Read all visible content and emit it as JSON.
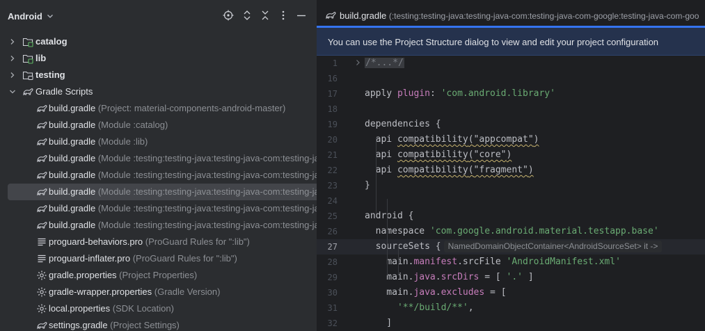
{
  "project_panel": {
    "view_name": "Android",
    "icons": [
      "locate-icon",
      "expand-all-icon",
      "collapse-all-icon",
      "more-options-icon",
      "hide-panel-icon"
    ],
    "tree": [
      {
        "label": "catalog",
        "hint": "",
        "icon": "module-folder-icon",
        "expandable": true,
        "bold": true
      },
      {
        "label": "lib",
        "hint": "",
        "icon": "module-folder-icon",
        "expandable": true,
        "bold": true
      },
      {
        "label": "testing",
        "hint": "",
        "icon": "folder-icon",
        "expandable": true,
        "bold": true
      },
      {
        "label": "Gradle Scripts",
        "hint": "",
        "icon": "gradle-icon",
        "expanded": true,
        "bold": false
      },
      {
        "label": "build.gradle",
        "hint": "(Project: material-components-android-master)",
        "icon": "gradle-icon"
      },
      {
        "label": "build.gradle",
        "hint": "(Module :catalog)",
        "icon": "gradle-icon"
      },
      {
        "label": "build.gradle",
        "hint": "(Module :lib)",
        "icon": "gradle-icon"
      },
      {
        "label": "build.gradle",
        "hint": "(Module :testing:testing-java:testing-java-com:testing-java-",
        "icon": "gradle-icon"
      },
      {
        "label": "build.gradle",
        "hint": "(Module :testing:testing-java:testing-java-com:testing-java-",
        "icon": "gradle-icon"
      },
      {
        "label": "build.gradle",
        "hint": "(Module :testing:testing-java:testing-java-com:testing-java-",
        "icon": "gradle-icon",
        "selected": true
      },
      {
        "label": "build.gradle",
        "hint": "(Module :testing:testing-java:testing-java-com:testing-java-",
        "icon": "gradle-icon"
      },
      {
        "label": "build.gradle",
        "hint": "(Module :testing:testing-java:testing-java-com:testing-java-",
        "icon": "gradle-icon"
      },
      {
        "label": "proguard-behaviors.pro",
        "hint": "(ProGuard Rules for \":lib\")",
        "icon": "text-file-icon"
      },
      {
        "label": "proguard-inflater.pro",
        "hint": "(ProGuard Rules for \":lib\")",
        "icon": "text-file-icon"
      },
      {
        "label": "gradle.properties",
        "hint": "(Project Properties)",
        "icon": "settings-file-icon"
      },
      {
        "label": "gradle-wrapper.properties",
        "hint": "(Gradle Version)",
        "icon": "settings-file-icon"
      },
      {
        "label": "local.properties",
        "hint": "(SDK Location)",
        "icon": "settings-file-icon"
      },
      {
        "label": "settings.gradle",
        "hint": "(Project Settings)",
        "icon": "gradle-icon"
      }
    ]
  },
  "editor": {
    "tab": {
      "label": "build.gradle",
      "hint": "(:testing:testing-java:testing-java-com:testing-java-com-google:testing-java-com-goo"
    },
    "banner": "You can use the Project Structure dialog to view and edit your project configuration",
    "current_line": "27",
    "lines": [
      {
        "n": "1",
        "tokens": [
          {
            "t": "/*...*/",
            "c": "cm fold-box"
          }
        ]
      },
      {
        "n": "16",
        "tokens": []
      },
      {
        "n": "17",
        "tokens": [
          {
            "t": "apply ",
            "c": ""
          },
          {
            "t": "plugin",
            "c": "p"
          },
          {
            "t": ": ",
            "c": ""
          },
          {
            "t": "'com.android.library'",
            "c": "s"
          }
        ]
      },
      {
        "n": "18",
        "tokens": []
      },
      {
        "n": "19",
        "tokens": [
          {
            "t": "dependencies {",
            "c": ""
          }
        ]
      },
      {
        "n": "20",
        "tokens": [
          {
            "t": "  api ",
            "c": ""
          },
          {
            "t": "compatibility",
            "c": "f"
          },
          {
            "t": "(",
            "c": "f"
          },
          {
            "t": "\"appcompat\"",
            "c": "s f"
          },
          {
            "t": ")",
            "c": "f"
          }
        ]
      },
      {
        "n": "21",
        "tokens": [
          {
            "t": "  api ",
            "c": ""
          },
          {
            "t": "compatibility",
            "c": "f"
          },
          {
            "t": "(",
            "c": "f"
          },
          {
            "t": "\"core\"",
            "c": "s f"
          },
          {
            "t": ")",
            "c": "f"
          }
        ]
      },
      {
        "n": "22",
        "tokens": [
          {
            "t": "  api ",
            "c": ""
          },
          {
            "t": "compatibility",
            "c": "f"
          },
          {
            "t": "(",
            "c": "f"
          },
          {
            "t": "\"fragment\"",
            "c": "s f"
          },
          {
            "t": ")",
            "c": "f"
          }
        ]
      },
      {
        "n": "23",
        "tokens": [
          {
            "t": "}",
            "c": ""
          }
        ]
      },
      {
        "n": "24",
        "tokens": []
      },
      {
        "n": "25",
        "tokens": [
          {
            "t": "android {",
            "c": ""
          }
        ]
      },
      {
        "n": "26",
        "tokens": [
          {
            "t": "  namespace ",
            "c": ""
          },
          {
            "t": "'com.google.android.material.testapp.base'",
            "c": "s"
          }
        ]
      },
      {
        "n": "27",
        "tokens": [
          {
            "t": "  sourceSets {",
            "c": ""
          }
        ],
        "inlay": "NamedDomainObjectContainer<AndroidSourceSet> it ->"
      },
      {
        "n": "28",
        "tokens": [
          {
            "t": "    main.",
            "c": ""
          },
          {
            "t": "manifest",
            "c": "p"
          },
          {
            "t": ".srcFile ",
            "c": ""
          },
          {
            "t": "'AndroidManifest.xml'",
            "c": "s"
          }
        ]
      },
      {
        "n": "29",
        "tokens": [
          {
            "t": "    main.",
            "c": ""
          },
          {
            "t": "java",
            "c": "p"
          },
          {
            "t": ".",
            "c": ""
          },
          {
            "t": "srcDirs",
            "c": "p"
          },
          {
            "t": " = [ ",
            "c": ""
          },
          {
            "t": "'.'",
            "c": "s"
          },
          {
            "t": " ]",
            "c": ""
          }
        ]
      },
      {
        "n": "30",
        "tokens": [
          {
            "t": "    main.",
            "c": ""
          },
          {
            "t": "java",
            "c": "p"
          },
          {
            "t": ".",
            "c": ""
          },
          {
            "t": "excludes",
            "c": "p"
          },
          {
            "t": " = [",
            "c": ""
          }
        ]
      },
      {
        "n": "31",
        "tokens": [
          {
            "t": "      ",
            "c": ""
          },
          {
            "t": "'**/build/**'",
            "c": "s"
          },
          {
            "t": ",",
            "c": ""
          }
        ]
      },
      {
        "n": "32",
        "tokens": [
          {
            "t": "    ]",
            "c": ""
          }
        ]
      }
    ]
  },
  "colors": {
    "panel_bg": "#2b2d30",
    "editor_bg": "#1e1f22",
    "selection": "#43454a",
    "accent": "#3574f0",
    "banner_bg": "#25324d"
  }
}
